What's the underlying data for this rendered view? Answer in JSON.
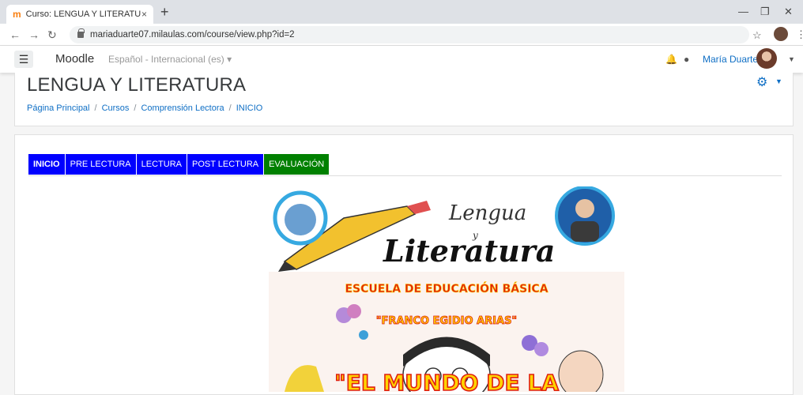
{
  "browser": {
    "tab_title": "Curso: LENGUA Y LITERATURA",
    "tab_close": "×",
    "new_tab": "+",
    "url": "mariaduarte07.milaulas.com/course/view.php?id=2"
  },
  "navbar": {
    "brand": "Moodle",
    "language": "Español - Internacional (es) ▾",
    "user_name": "María Duarte"
  },
  "header": {
    "course_title": "LENGUA Y LITERATURA",
    "breadcrumb": [
      "Página Principal",
      "Cursos",
      "Comprensión Lectora",
      "INICIO"
    ]
  },
  "tabs": [
    {
      "label": "INICIO"
    },
    {
      "label": "PRE LECTURA"
    },
    {
      "label": "LECTURA"
    },
    {
      "label": "POST LECTURA"
    },
    {
      "label": "EVALUACIÓN"
    }
  ],
  "poster": {
    "logo_script": "Lengua",
    "logo_and": "y",
    "logo_main": "Literatura",
    "school_line1": "ESCUELA DE EDUCACIÓN BÁSICA",
    "school_line2": "\"FRANCO EGIDIO ARIAS\"",
    "headline": "\"EL MUNDO DE LA"
  },
  "colors": {
    "tab_blue": "#0000ff",
    "tab_green": "#008000",
    "link_blue": "#0f6fc5",
    "poster_text_yellow": "#ffd400",
    "poster_text_red": "#e02010"
  },
  "icons": [
    "back-arrow-icon",
    "forward-arrow-icon",
    "reload-icon",
    "lock-icon",
    "star-icon",
    "menu-icon",
    "bell-icon",
    "chat-icon",
    "gear-icon"
  ]
}
